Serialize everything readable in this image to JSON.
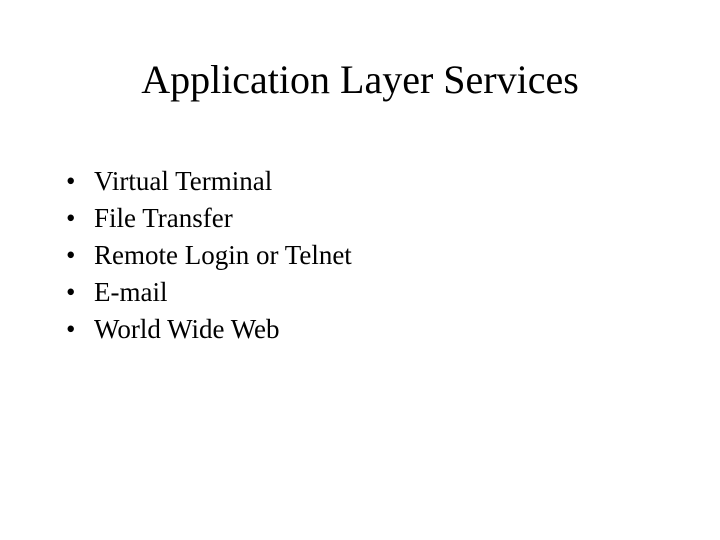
{
  "title": "Application Layer Services",
  "bullets": [
    "Virtual Terminal",
    "File Transfer",
    "Remote Login or Telnet",
    "E-mail",
    "World Wide Web"
  ]
}
